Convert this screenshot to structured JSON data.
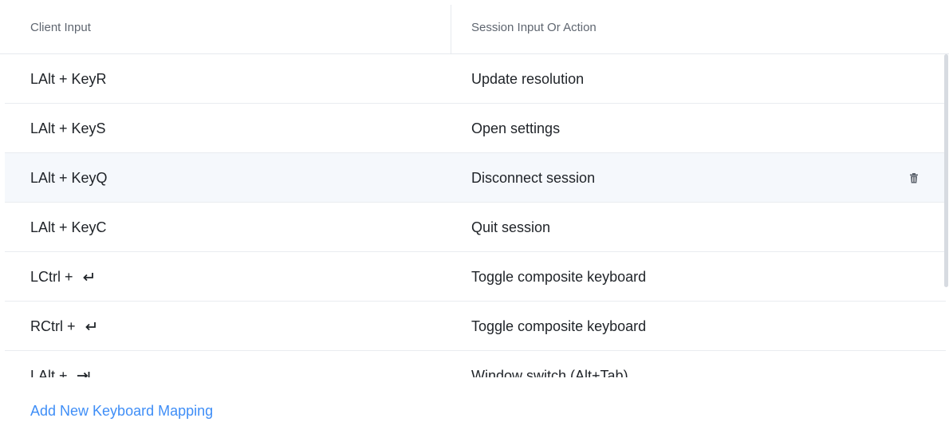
{
  "table": {
    "columns": [
      "Client Input",
      "Session Input Or Action"
    ],
    "rows": [
      {
        "client_prefix": "LAlt + KeyR",
        "client_icon": "",
        "action": "Update resolution"
      },
      {
        "client_prefix": "LAlt + KeyS",
        "client_icon": "",
        "action": "Open settings"
      },
      {
        "client_prefix": "LAlt + KeyQ",
        "client_icon": "",
        "action": "Disconnect session",
        "hovered": true
      },
      {
        "client_prefix": "LAlt + KeyC",
        "client_icon": "",
        "action": "Quit session"
      },
      {
        "client_prefix": "LCtrl + ",
        "client_icon": "return-key-icon",
        "action": "Toggle composite keyboard"
      },
      {
        "client_prefix": "RCtrl + ",
        "client_icon": "return-key-icon",
        "action": "Toggle composite keyboard"
      },
      {
        "client_prefix": "LAlt + ",
        "client_icon": "tab-key-icon",
        "action": "Window switch (Alt+Tab)"
      }
    ],
    "delete_icon": "trash-icon"
  },
  "actions": {
    "add_label": "Add New Keyboard Mapping"
  },
  "colors": {
    "accent": "#3f8ef7",
    "hover_row": "#f5f8fc",
    "header_text": "#5f6670"
  }
}
